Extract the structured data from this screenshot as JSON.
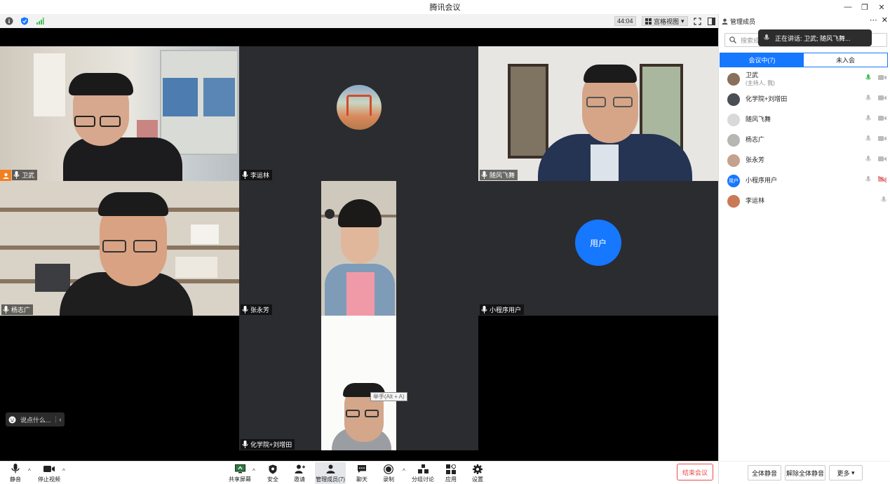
{
  "window": {
    "title": "腾讯会议"
  },
  "toolbar": {
    "timer": "44:04",
    "view_label": "宫格视图"
  },
  "tiles": [
    {
      "name": "卫武",
      "host": true
    },
    {
      "name": "李运林"
    },
    {
      "name": "随风飞舞"
    },
    {
      "name": "杨志广"
    },
    {
      "name": "张永芳"
    },
    {
      "name": "小程序用户"
    },
    {
      "name": "化学院+刘增田"
    }
  ],
  "user_avatar_label": "用户",
  "chat_pill": {
    "text": "说点什么..."
  },
  "tooltip": "举手(Alt + A)",
  "bottom": {
    "mute": "静音",
    "stop_video": "停止视频",
    "share": "共享屏幕",
    "security": "安全",
    "invite": "邀请",
    "members": "管理成员(7)",
    "chat": "聊天",
    "record": "录制",
    "breakout": "分组讨论",
    "apps": "应用",
    "settings": "设置",
    "end": "结束会议"
  },
  "panel": {
    "title": "管理成员",
    "search_placeholder": "搜索成员",
    "speaking": "正在讲话: 卫武; 随风飞舞...",
    "tab_in": "会议中(7)",
    "tab_out": "未入会",
    "members": [
      {
        "name": "卫武",
        "sub": "(主持人, 我)"
      },
      {
        "name": "化学院+刘增田"
      },
      {
        "name": "随风飞舞"
      },
      {
        "name": "杨志广"
      },
      {
        "name": "张永芳"
      },
      {
        "name": "小程序用户",
        "avatar_label": "用户"
      },
      {
        "name": "李运林"
      }
    ],
    "mute_all": "全体静音",
    "unmute_all": "解除全体静音",
    "more": "更多"
  },
  "colors": {
    "accent": "#1677ff",
    "active_speaker": "#3bbd4b",
    "end": "#e94c4c"
  }
}
